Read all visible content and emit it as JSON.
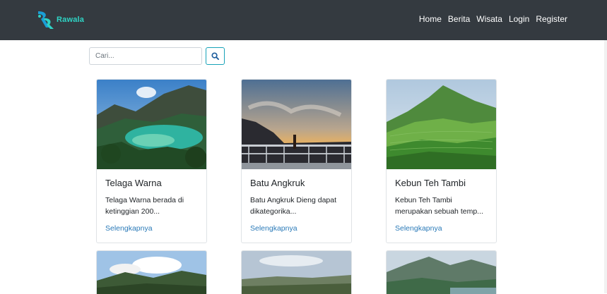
{
  "brand": {
    "name": "Rawala"
  },
  "nav": {
    "items": [
      {
        "label": "Home"
      },
      {
        "label": "Berita"
      },
      {
        "label": "Wisata"
      },
      {
        "label": "Login"
      },
      {
        "label": "Register"
      }
    ]
  },
  "search": {
    "placeholder": "Cari...",
    "button_icon": "search-icon"
  },
  "cards": [
    {
      "title": "Telaga Warna",
      "text": "Telaga Warna berada di ketinggian 200...",
      "link": "Selengkapnya"
    },
    {
      "title": "Batu Angkruk",
      "text": "Batu Angkruk Dieng dapat dikategorika...",
      "link": "Selengkapnya"
    },
    {
      "title": "Kebun Teh Tambi",
      "text": "Kebun Teh Tambi merupakan sebuah temp...",
      "link": "Selengkapnya"
    }
  ],
  "colors": {
    "navbar": "#343a40",
    "brand_accent": "#2fd3c4",
    "link": "#2a7ab8",
    "search_button_border": "#17a2b8"
  }
}
